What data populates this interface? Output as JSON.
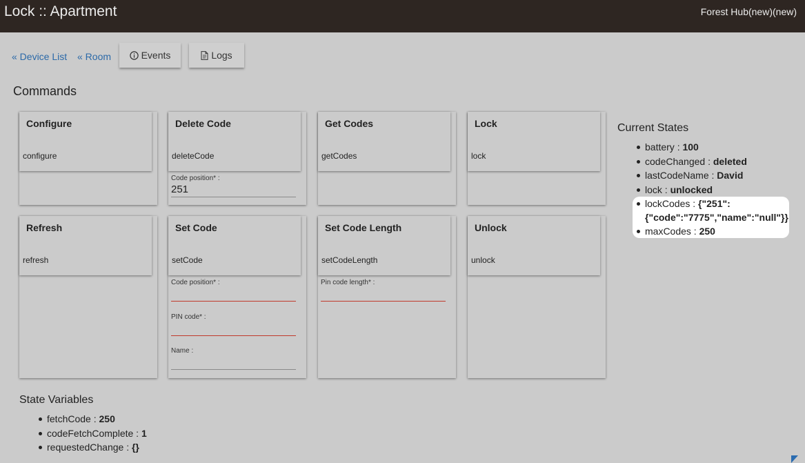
{
  "header": {
    "title": "Lock :: Apartment",
    "hub": "Forest Hub(new)(new)"
  },
  "nav": {
    "device_list": "« Device List",
    "room": "« Room",
    "events": "Events",
    "logs": "Logs"
  },
  "commands": {
    "title": "Commands",
    "configure": {
      "name": "Configure",
      "method": "configure"
    },
    "delete_code": {
      "name": "Delete Code",
      "method": "deleteCode",
      "code_position_label": "Code position* :",
      "code_position_value": "251"
    },
    "get_codes": {
      "name": "Get Codes",
      "method": "getCodes"
    },
    "lock": {
      "name": "Lock",
      "method": "lock"
    },
    "refresh": {
      "name": "Refresh",
      "method": "refresh"
    },
    "set_code": {
      "name": "Set Code",
      "method": "setCode",
      "code_position_label": "Code position* :",
      "pin_label": "PIN code* :",
      "name_label": "Name :"
    },
    "set_code_length": {
      "name": "Set Code Length",
      "method": "setCodeLength",
      "pin_length_label": "Pin code length* :"
    },
    "unlock": {
      "name": "Unlock",
      "method": "unlock"
    }
  },
  "current_states": {
    "title": "Current States",
    "items": [
      {
        "key": "battery",
        "value": "100"
      },
      {
        "key": "codeChanged",
        "value": "deleted"
      },
      {
        "key": "lastCodeName",
        "value": "David"
      },
      {
        "key": "lock",
        "value": "unlocked"
      },
      {
        "key": "lockCodes",
        "value": "{\"251\":",
        "value2": "{\"code\":\"7775\",\"name\":\"null\"}}"
      },
      {
        "key": "maxCodes",
        "value": "250"
      }
    ]
  },
  "state_variables": {
    "title": "State Variables",
    "items": [
      {
        "key": "fetchCode",
        "value": "250"
      },
      {
        "key": "codeFetchComplete",
        "value": "1"
      },
      {
        "key": "requestedChange",
        "value": "{}"
      }
    ]
  },
  "icons": {
    "events": "info-circle-icon",
    "logs": "document-icon"
  }
}
